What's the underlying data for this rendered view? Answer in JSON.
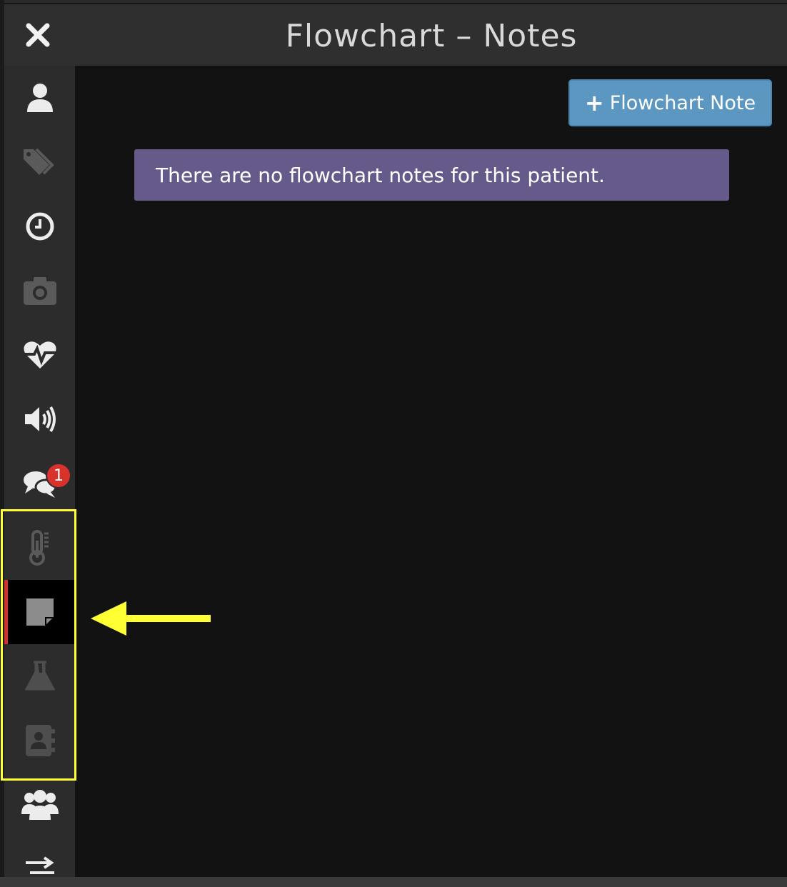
{
  "window": {
    "title": "Flowchart – Notes",
    "close_icon": "close-icon"
  },
  "sidebar": {
    "items": [
      {
        "id": "patient",
        "icon": "user-icon",
        "active": false
      },
      {
        "id": "tags",
        "icon": "tags-icon",
        "active": false
      },
      {
        "id": "history",
        "icon": "clock-icon",
        "active": false
      },
      {
        "id": "photos",
        "icon": "camera-icon",
        "active": false
      },
      {
        "id": "vitals",
        "icon": "heartbeat-icon",
        "active": false
      },
      {
        "id": "audio",
        "icon": "volume-icon",
        "active": false
      },
      {
        "id": "messages",
        "icon": "chat-icon",
        "active": false,
        "badge": "1"
      },
      {
        "id": "flowchart",
        "icon": "thermometer-icon",
        "active": false
      },
      {
        "id": "notes",
        "icon": "sticky-note-icon",
        "active": true
      },
      {
        "id": "labs",
        "icon": "flask-icon",
        "active": false
      },
      {
        "id": "contacts",
        "icon": "address-book-icon",
        "active": false
      },
      {
        "id": "group",
        "icon": "users-icon",
        "active": false
      },
      {
        "id": "transfer",
        "icon": "exchange-icon",
        "active": false
      }
    ]
  },
  "main": {
    "add_button_label": "Flowchart Note",
    "empty_message": "There are no flowchart notes for this patient."
  },
  "annotation": {
    "highlight_color": "#ffff33",
    "active_accent": "#d0312d"
  }
}
